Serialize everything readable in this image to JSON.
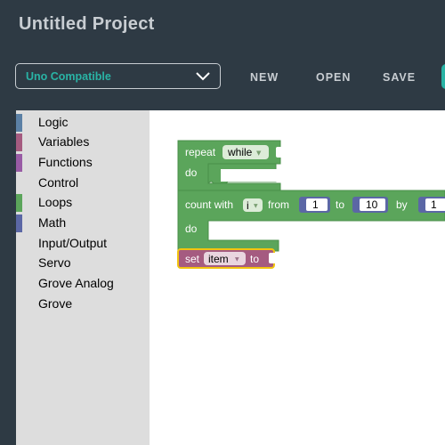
{
  "project": {
    "title": "Untitled Project"
  },
  "board": {
    "selected": "Uno Compatible"
  },
  "toolbar": {
    "new_label": "NEW",
    "open_label": "OPEN",
    "save_label": "SAVE"
  },
  "colors": {
    "accent": "#29b3a5",
    "header_bg": "#2e3a44",
    "loops": "#5ba55b",
    "variables": "#a55b80",
    "selection": "#f2c40f"
  },
  "sidebar": {
    "items": [
      {
        "label": "Logic",
        "color": "#5b80a5"
      },
      {
        "label": "Variables",
        "color": "#a55b80"
      },
      {
        "label": "Functions",
        "color": "#995ba5"
      },
      {
        "label": "Control",
        "color": ""
      },
      {
        "label": "Loops",
        "color": "#5ba55b"
      },
      {
        "label": "Math",
        "color": "#5b67a5"
      },
      {
        "label": "Input/Output",
        "color": ""
      },
      {
        "label": "Servo",
        "color": ""
      },
      {
        "label": "Grove Analog",
        "color": ""
      },
      {
        "label": "Grove",
        "color": ""
      }
    ]
  },
  "blocks": {
    "repeat": {
      "keyword": "repeat",
      "mode": "while",
      "do_label": "do"
    },
    "count": {
      "keyword": "count with",
      "var": "i",
      "from_label": "from",
      "from_value": "1",
      "to_label": "to",
      "to_value": "10",
      "by_label": "by",
      "by_value": "1",
      "do_label": "do"
    },
    "set": {
      "keyword": "set",
      "var": "item",
      "to_label": "to"
    }
  }
}
